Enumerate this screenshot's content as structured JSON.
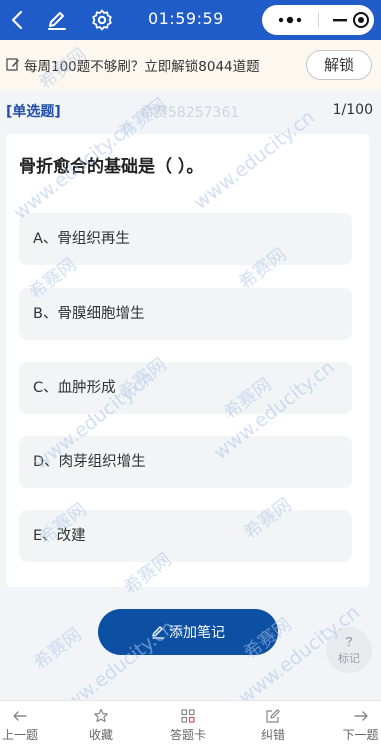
{
  "header": {
    "time": "01:59:59",
    "icons": [
      "back-icon",
      "edit-icon",
      "gear-icon",
      "more-icon",
      "minimize-icon",
      "record-icon"
    ]
  },
  "banner": {
    "text": "每周100题不够刷？立即解锁8044道题",
    "unlock_label": "解锁"
  },
  "question": {
    "type_label": "[单选题]",
    "id_label": "希赛58257361",
    "progress": "1/100",
    "stem": "骨折愈合的基础是（  ）。",
    "options": [
      "A、骨组织再生",
      "B、骨膜细胞增生",
      "C、血肿形成",
      "D、肉芽组织增生",
      "E、改建"
    ]
  },
  "actions": {
    "add_note_label": "添加笔记",
    "mark_label": "标记"
  },
  "bottom_bar": {
    "prev_label": "上一题",
    "fav_label": "收藏",
    "card_label": "答题卡",
    "correct_label": "纠错",
    "next_label": "下一题"
  },
  "watermark": {
    "brand": "希赛网",
    "domain": "www.educity.cn"
  },
  "colors": {
    "topbar": "#1f5cc7",
    "accent": "#0d4fa3",
    "banner_bg": "#fdf8ef",
    "type_label": "#1f4fa8"
  }
}
